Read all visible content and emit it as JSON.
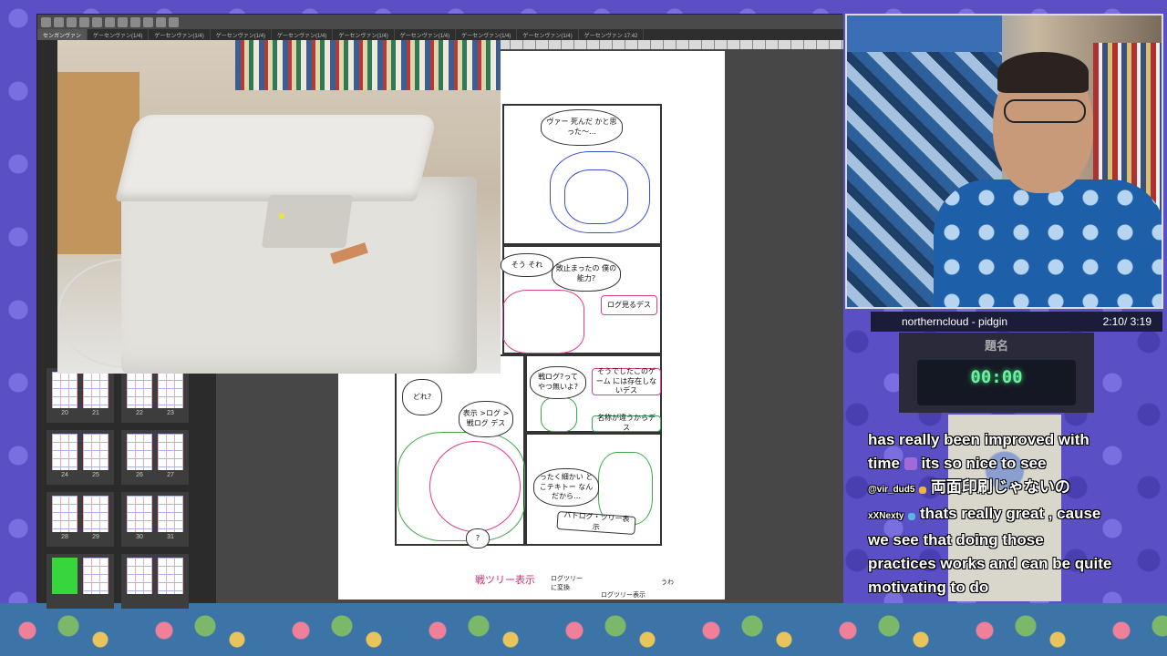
{
  "app": {
    "tabs": [
      "センガンヴァン",
      "ゲーセンヴァン(1/4)",
      "ゲーセンヴァン(1/4)",
      "ゲーセンヴァン(1/4)",
      "ゲーセンヴァン(1/4)",
      "ゲーセンヴァン(1/4)",
      "ゲーセンヴァン(1/4)",
      "ゲーセンヴァン(1/4)",
      "ゲーセンヴァン(1/4)",
      "ゲーセンヴァン 17:42"
    ],
    "page_numbers": [
      "20",
      "21",
      "22",
      "23",
      "24",
      "25",
      "26",
      "27",
      "28",
      "29",
      "30",
      "31"
    ]
  },
  "manga": {
    "bubble1": "ヴ⁠ァー 死んだ かと思った～…",
    "bubble2": "そう それ",
    "bubble3": "敗止まったの 僕の能力?",
    "bubble4": "ログ見るデス",
    "bubble5": "どれ?",
    "bubble6": "戦ログ?って やつ無いよ?",
    "bubble7": "そうでしたこのゲーム には存在しないデス",
    "bubble8": "名称が違うからデス",
    "bubble9": "表示 >ログ >戦ログ デス",
    "bubble10": "ったく細かい とこテキトー なんだから…",
    "bubble11": "バトログ・ツリー表示",
    "bubble12": "?",
    "note_pink": "戦ツリー表示",
    "note1": "ログツリー に変換",
    "note2": "ログツリー表示",
    "note3": "うわ"
  },
  "now_playing": {
    "track": "northerncloud - pidgin",
    "time": "2:10/ 3:19"
  },
  "timer": {
    "title": "題名",
    "value": "00:00"
  },
  "chat": {
    "line1": "has really been improved with",
    "line2": "time",
    "line2b": "its so nice to see",
    "user1": "@vir_dud5",
    "msg1": "両面印刷じゃないの",
    "user2": "xXNexty",
    "msg2a": "thats really great , cause",
    "msg2b": "we see that doing those",
    "msg2c": "practices works and can be quite",
    "msg2d": "motivating to do"
  }
}
